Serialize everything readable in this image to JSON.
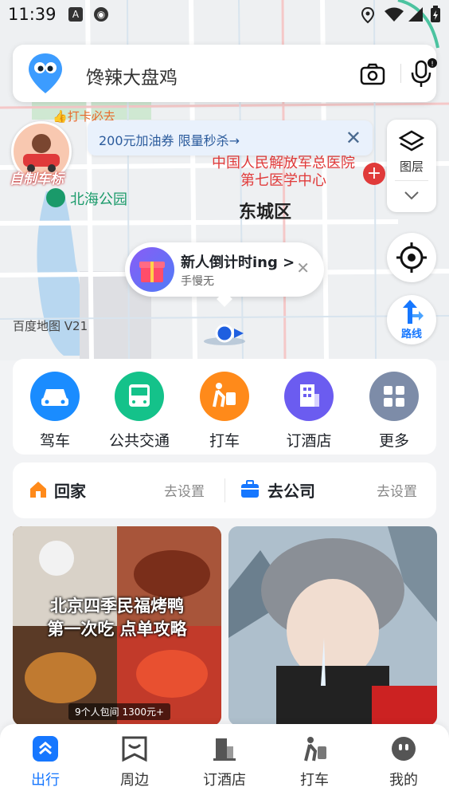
{
  "status_bar": {
    "time": "11:39"
  },
  "search": {
    "placeholder": "馋辣大盘鸡"
  },
  "map": {
    "poi_top": "打卡必去",
    "self_car_label": "自制车标",
    "promo_text": "200元加油券 限量秒杀→",
    "hospital_line1": "中国人民解放军总医院",
    "hospital_line2": "第七医学中心",
    "park": "北海公园",
    "district": "东城区",
    "watermark": "百度地图 V21",
    "bubble_title": "新人倒计时ing",
    "bubble_arrow": ">",
    "bubble_sub": "手慢无"
  },
  "controls": {
    "layers_label": "图层",
    "route_label": "路线"
  },
  "quick_nav": [
    {
      "label": "驾车",
      "icon": "car-icon",
      "color": "#1a8cff"
    },
    {
      "label": "公共交通",
      "icon": "bus-icon",
      "color": "#14c28a"
    },
    {
      "label": "打车",
      "icon": "taxi-icon",
      "color": "#ff8a1a"
    },
    {
      "label": "订酒店",
      "icon": "hotel-icon",
      "color": "#6b5cf0"
    },
    {
      "label": "更多",
      "icon": "grid-icon",
      "color": "#7d8ca8"
    }
  ],
  "home_work": {
    "home_label": "回家",
    "home_set": "去设置",
    "work_label": "去公司",
    "work_set": "去设置"
  },
  "feed": {
    "card1_title_1": "北京四季民福烤鸭",
    "card1_title_2": "第一次吃 点单攻略",
    "card1_tag": "9个人包间 1300元+"
  },
  "tabs": [
    {
      "label": "出行",
      "icon": "travel-icon",
      "active": true
    },
    {
      "label": "周边",
      "icon": "nearby-icon",
      "active": false
    },
    {
      "label": "订酒店",
      "icon": "hotel-icon",
      "active": false
    },
    {
      "label": "打车",
      "icon": "taxi-icon",
      "active": false
    },
    {
      "label": "我的",
      "icon": "profile-icon",
      "active": false
    }
  ],
  "colors": {
    "accent": "#1677ff",
    "hospital_red": "#e03a3a",
    "park_green": "#1a9a6a"
  }
}
